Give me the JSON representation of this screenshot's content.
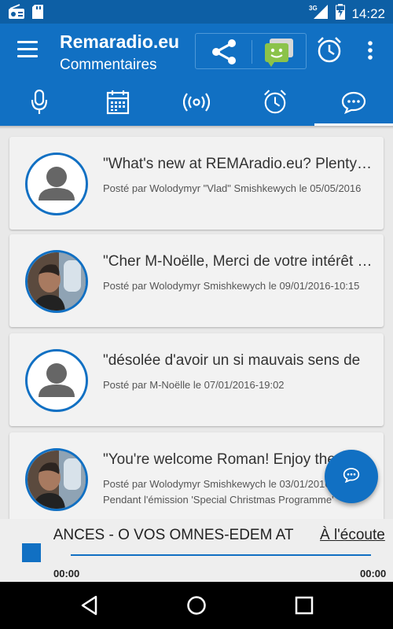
{
  "status_bar": {
    "time": "14:22",
    "network_label": "3G",
    "icons": [
      "radio-icon",
      "sd-card-icon",
      "signal-icon",
      "battery-icon"
    ]
  },
  "app_bar": {
    "title": "Remaradio.eu",
    "subtitle": "Commentaires",
    "actions": [
      "menu-icon",
      "share-icon",
      "sms-icon",
      "alarm-icon",
      "more-vert-icon"
    ]
  },
  "tabs": {
    "items": [
      {
        "icon": "microphone-icon",
        "active": false
      },
      {
        "icon": "calendar-icon",
        "active": false
      },
      {
        "icon": "broadcast-icon",
        "active": false
      },
      {
        "icon": "alarm-icon",
        "active": false
      },
      {
        "icon": "chat-bubble-icon",
        "active": true
      }
    ]
  },
  "comments": [
    {
      "avatar": "default-user-icon",
      "title": "\"What's new at REMAradio.eu? Plenty of new",
      "meta": "Posté par Wolodymyr \"Vlad\" Smishkewych le 05/05/2016",
      "extra": ""
    },
    {
      "avatar": "photo-avatar",
      "title": "\"Cher M-Noëlle, Merci de votre intérêt pour",
      "meta": "Posté par Wolodymyr  Smishkewych le 09/01/2016-10:15",
      "extra": ""
    },
    {
      "avatar": "default-user-icon",
      "title": "\"désolée d'avoir un si mauvais sens de",
      "meta": "Posté par M-Noëlle le 07/01/2016-19:02",
      "extra": ""
    },
    {
      "avatar": "photo-avatar",
      "title": "\"You're welcome Roman! Enjoy the",
      "meta": "Posté par Wolodymyr  Smishkewych le 03/01/2016",
      "extra": "Pendant l'émission 'Special Christmas Programme'"
    }
  ],
  "fab": {
    "icon": "chat-bubble-icon"
  },
  "player": {
    "now_playing": "DANCES - O VOS OMNES-EDEM AT",
    "listen_label": "À l'écoute",
    "time_elapsed": "00:00",
    "time_total": "00:00"
  },
  "colors": {
    "primary": "#1170c3",
    "status_bar": "#0d5fa5",
    "background": "#e9e9e9",
    "card": "#f2f2f2",
    "sms_green": "#8bc34a"
  }
}
